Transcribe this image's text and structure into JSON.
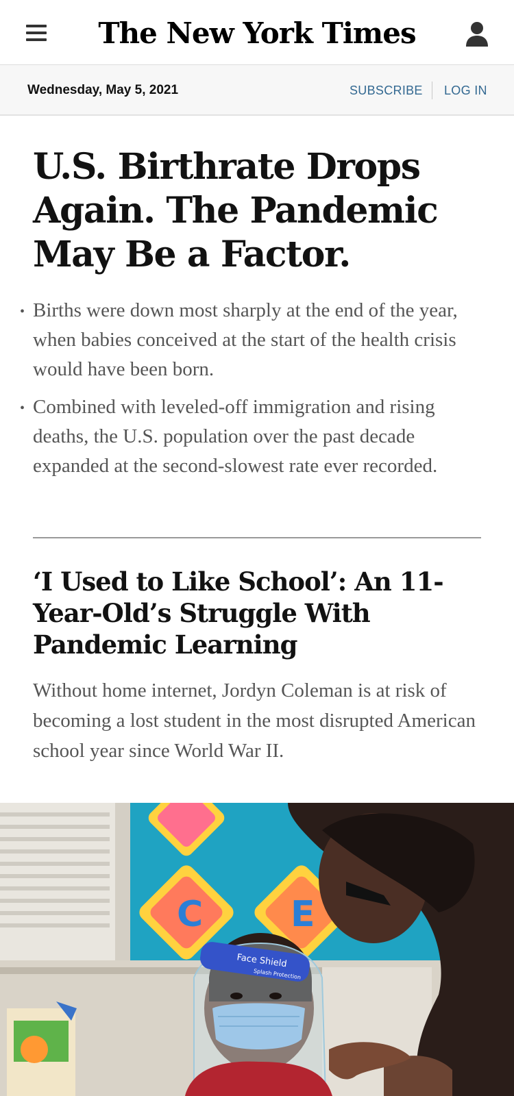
{
  "header": {
    "masthead": "The New York Times",
    "menu_icon": "hamburger-menu-icon",
    "account_icon": "user-account-icon"
  },
  "datebar": {
    "date": "Wednesday, May 5, 2021",
    "subscribe_label": "SUBSCRIBE",
    "login_label": "LOG IN"
  },
  "story1": {
    "headline": "U.S. Birthrate Drops Again. The Pandemic May Be a Factor.",
    "summary": [
      "Births were down most sharply at the end of the year, when babies conceived at the start of the health crisis would have been born.",
      "Combined with leveled-off immigration and rising deaths, the U.S. population over the past decade expanded at the second-slowest rate ever recorded."
    ]
  },
  "story2": {
    "headline": "‘I Used to Like School’: An 11-Year-Old’s Struggle With Pandemic Learning",
    "summary": "Without home internet, Jordyn Coleman is at risk of becoming a lost student in the most disrupted American school year since World War II."
  },
  "photo": {
    "wall_letters": [
      "C",
      "E"
    ],
    "face_shield_text": "Face Shield",
    "face_shield_subtext": "Splash Protection"
  },
  "colors": {
    "link_blue": "#326891",
    "headline_black": "#121212",
    "summary_gray": "#555555",
    "datebar_bg": "#f7f7f7",
    "photo_wall_blue": "#1fa3c2"
  }
}
